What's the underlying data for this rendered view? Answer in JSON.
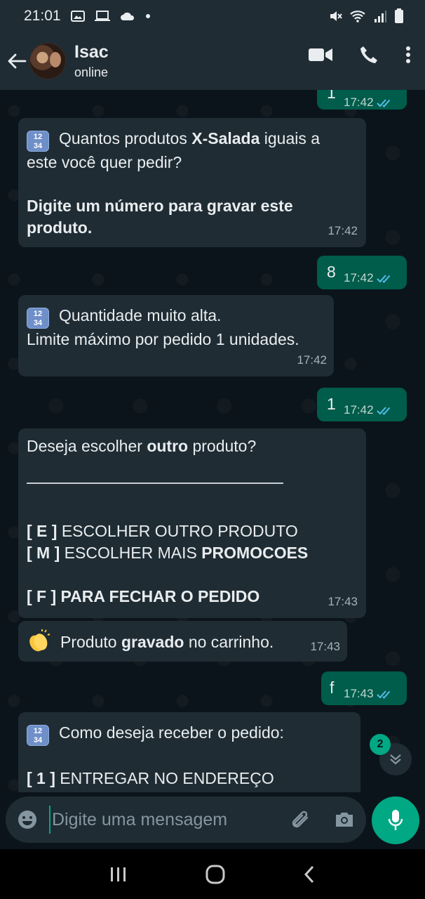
{
  "status_bar": {
    "time": "21:01"
  },
  "header": {
    "name": "Isac",
    "status": "online"
  },
  "messages": {
    "m0": {
      "text": "1",
      "time": "17:42"
    },
    "m1": {
      "line1_a": "Quantos produtos ",
      "line1_b": "X-Salada",
      "line1_c": " iguais a",
      "line2": "este você quer pedir?",
      "line3": " Digite um número para gravar este",
      "line4": "produto.",
      "time": "17:42"
    },
    "m2": {
      "text": "8",
      "time": "17:42"
    },
    "m3": {
      "line1": "Quantidade muito alta.",
      "line2": "Limite máximo por pedido 1 unidades.",
      "time": "17:42"
    },
    "m4": {
      "text": "1",
      "time": "17:42"
    },
    "m5": {
      "line1_a": "Deseja escolher ",
      "line1_b": "outro",
      "line1_c": " produto?",
      "opt_e_key": "[ E ]",
      "opt_e_text": " ESCOLHER OUTRO PRODUTO",
      "opt_m_key": "[ M ]",
      "opt_m_text": " ESCOLHER MAIS ",
      "opt_m_bold": "PROMOCOES",
      "opt_f_key": "[ F ]",
      "opt_f_text": " PARA FECHAR O PEDIDO",
      "time": "17:43"
    },
    "m6": {
      "text_a": "Produto ",
      "text_b": "gravado",
      "text_c": " no carrinho.",
      "time": "17:43"
    },
    "m7": {
      "text": "f",
      "time": "17:43"
    },
    "m8": {
      "line1": "Como deseja receber o pedido:",
      "opt1_key": "[ 1 ]",
      "opt1_text": " ENTREGAR NO ENDEREÇO"
    }
  },
  "unread_count": "2",
  "input": {
    "placeholder": "Digite uma mensagem"
  },
  "colors": {
    "incoming_bubble": "#1f2c34",
    "outgoing_bubble": "#005c4b",
    "accent": "#00a884",
    "read_tick": "#53bdeb"
  }
}
